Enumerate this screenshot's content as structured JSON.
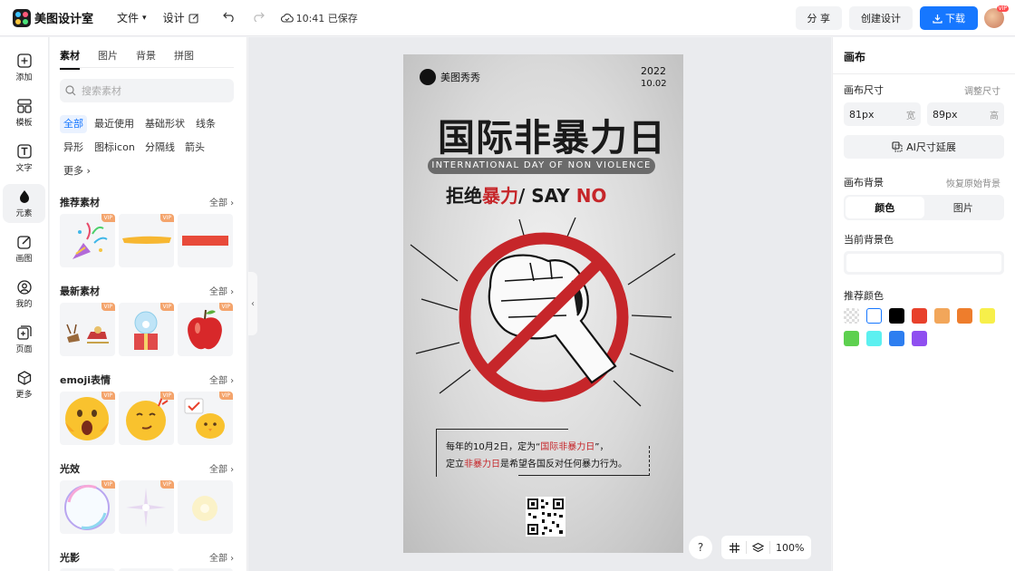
{
  "app": {
    "name": "美图设计室"
  },
  "topbar": {
    "file_label": "文件",
    "design_label": "设计",
    "save_status": "10:41 已保存",
    "share_label": "分 享",
    "create_label": "创建设计",
    "download_label": "下载",
    "avatar_badge": "VIP"
  },
  "rail": {
    "items": [
      {
        "label": "添加",
        "icon": "add-icon"
      },
      {
        "label": "模板",
        "icon": "template-icon"
      },
      {
        "label": "文字",
        "icon": "text-icon"
      },
      {
        "label": "元素",
        "icon": "element-icon",
        "active": true
      },
      {
        "label": "画图",
        "icon": "draw-icon"
      },
      {
        "label": "我的",
        "icon": "user-icon"
      },
      {
        "label": "页面",
        "icon": "page-icon"
      },
      {
        "label": "更多",
        "icon": "more-icon"
      }
    ]
  },
  "panel": {
    "tabs": [
      "素材",
      "图片",
      "背景",
      "拼图"
    ],
    "active_tab": "素材",
    "search_placeholder": "搜索素材",
    "chips": [
      "全部",
      "最近使用",
      "基础形状",
      "线条",
      "异形",
      "图标icon",
      "分隔线",
      "箭头",
      "更多"
    ],
    "all_label": "全部",
    "vip_label": "VIP",
    "sections": [
      {
        "title": "推荐素材",
        "tiles": [
          "confetti-popper",
          "yellow-brush-stroke",
          "red-rectangle"
        ]
      },
      {
        "title": "最新素材",
        "tiles": [
          "reindeer-sleigh",
          "gift-snow-globe",
          "red-apple"
        ]
      },
      {
        "title": "emoji表情",
        "tiles": [
          "shocked-emoji",
          "thinking-emoji",
          "chick-emoji"
        ]
      },
      {
        "title": "光效",
        "tiles": [
          "rainbow-bubble",
          "sparkle-star",
          "soft-glow"
        ]
      },
      {
        "title": "光影",
        "tiles": []
      }
    ]
  },
  "poster": {
    "brand": "美图秀秀",
    "year": "2022",
    "date": "10.02",
    "title": "国际非暴力日",
    "subtitle_en": "INTERNATIONAL DAY OF NON VIOLENCE",
    "slogan_part1": "拒绝",
    "slogan_part2": "暴力",
    "slogan_part3": "/  SAY ",
    "slogan_part4": "NO",
    "body_line1_a": "每年的10月2日，定为“",
    "body_line1_b": "国际非暴力日",
    "body_line1_c": "”，",
    "body_line2_a": "定立",
    "body_line2_b": "非暴力日",
    "body_line2_c": "是希望各国反对任何暴力行为。"
  },
  "canvas_tools": {
    "help": "?",
    "zoom": "100%"
  },
  "right_panel": {
    "title": "画布",
    "size_label": "画布尺寸",
    "adjust_size": "调整尺寸",
    "width_value": "81px",
    "width_unit": "宽",
    "height_value": "89px",
    "height_unit": "高",
    "ai_extend": "AI尺寸延展",
    "bg_label": "画布背景",
    "restore_bg": "恢复原始背景",
    "seg_color": "颜色",
    "seg_image": "图片",
    "current_bg": "当前背景色",
    "recommended": "推荐颜色",
    "swatches": [
      "transparent",
      "#ffffff",
      "#000000",
      "#e8412c",
      "#f2a65a",
      "#ee7d2c",
      "#f7ef4a",
      "#5dd04f",
      "#5cf0f0",
      "#2d7ef0",
      "#8f4ff0"
    ]
  },
  "colors": {
    "accent": "#1677ff",
    "poster_red": "#c6262a"
  }
}
